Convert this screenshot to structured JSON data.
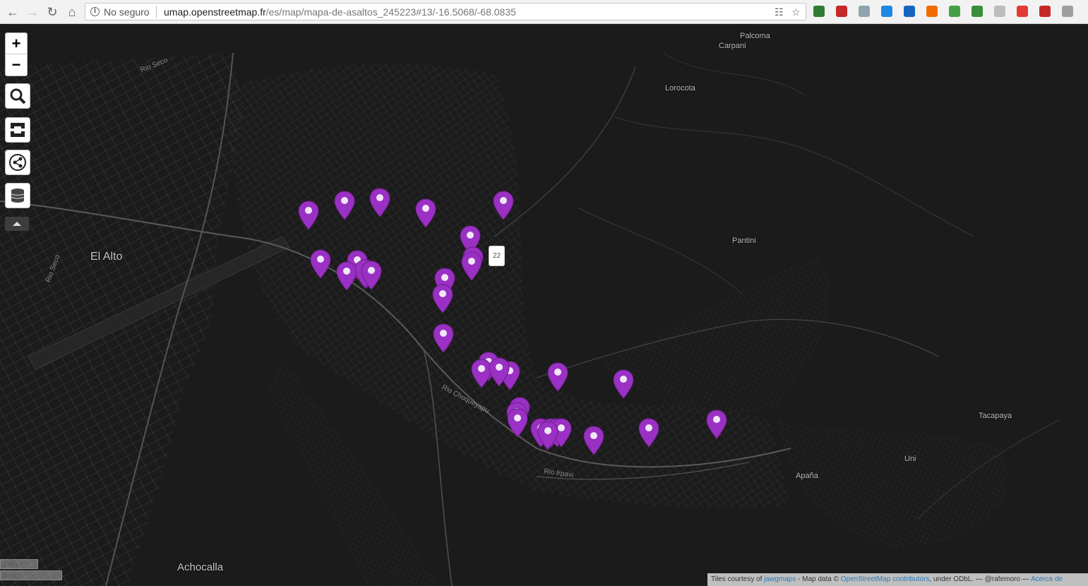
{
  "browser": {
    "security_label": "No seguro",
    "url_host": "umap.openstreetmap.fr",
    "url_path": "/es/map/mapa-de-asaltos_245223#13/-16.5068/-68.0835",
    "extension_colors": [
      "#2e7d32",
      "#c62828",
      "#90a4ae",
      "#1e88e5",
      "#1565c0",
      "#ef6c00",
      "#43a047",
      "#388e3c",
      "#bdbdbd",
      "#e53935",
      "#c62828",
      "#9e9e9e"
    ]
  },
  "map": {
    "places": {
      "el_alto": "El Alto",
      "achocalla": "Achocalla",
      "palcoma": "Palcoma",
      "carpani": "Carpani",
      "lorocota": "Lorocota",
      "pantini": "Pantini",
      "tacapaya": "Tacapaya",
      "uni": "Uni",
      "apana": "Apaña"
    },
    "rivers": {
      "rio_seco_1": "Rio Seco",
      "rio_seco_2": "Rio Seco",
      "rio_choqueyapu": "Rio Choqueyapu",
      "rio_irpavi": "Rio Irpavi"
    },
    "marker_color": "#9b30c4",
    "marker_count": 34,
    "tooltip": "22",
    "scale_km": "1 km",
    "scale_mi": "1 mi"
  },
  "attribution": {
    "prefix": "Tiles courtesy of",
    "jawg": "jawgmaps",
    "mid": "- Map data ©",
    "osm": "OpenStreetMap contributors",
    "suffix": ", under ODbL. — @rafemoro —",
    "about": "Acerca de"
  }
}
